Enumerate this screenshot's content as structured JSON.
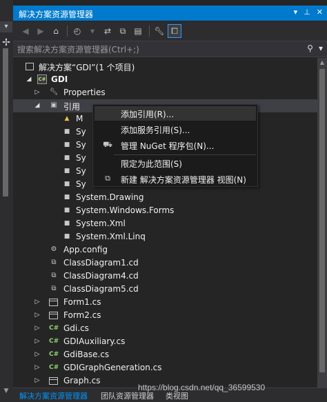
{
  "panel": {
    "title": "解决方案资源管理器",
    "title_icons": [
      "dropdown-arrow-icon",
      "pin-icon",
      "close-icon"
    ]
  },
  "toolbar": {
    "buttons": [
      "back-icon",
      "forward-icon",
      "home-icon",
      "history-icon",
      "sync-icon",
      "collapse-all-icon",
      "show-all-files-icon",
      "properties-icon",
      "preview-icon"
    ]
  },
  "search": {
    "placeholder": "搜索解决方案资源管理器(Ctrl+;)"
  },
  "tree": {
    "solution": "解决方案“GDI”(1 个项目)",
    "project": "GDI",
    "properties": "Properties",
    "references": "引用",
    "ref_items": [
      "M",
      "Sy",
      "Sy",
      "Sy",
      "Sy",
      "Sy",
      "System.Drawing",
      "System.Windows.Forms",
      "System.Xml",
      "System.Xml.Linq"
    ],
    "app_config": "App.config",
    "class_diagrams": [
      "ClassDiagram1.cd",
      "ClassDiagram4.cd",
      "ClassDiagram5.cd"
    ],
    "forms": [
      "Form1.cs",
      "Form2.cs"
    ],
    "cs_files": [
      "Gdi.cs",
      "GDIAuxiliary.cs",
      "GdiBase.cs",
      "GDIGraphGeneration.cs"
    ],
    "last_form": "Graph.cs"
  },
  "context_menu": {
    "items": [
      {
        "label": "添加引用(R)...",
        "icon": ""
      },
      {
        "label": "添加服务引用(S)...",
        "icon": ""
      },
      {
        "label": "管理 NuGet 程序包(N)...",
        "icon": "nuget-icon"
      },
      {
        "label": "限定为此范围(S)",
        "icon": ""
      },
      {
        "label": "新建 解决方案资源管理器 视图(N)",
        "icon": "new-view-icon"
      }
    ]
  },
  "bottom_tabs": {
    "active": "解决方案资源管理器",
    "inactive1": "团队资源管理器",
    "inactive2": "类视图"
  },
  "watermark": "https://blog.csdn.net/qq_36599530",
  "colors": {
    "accent": "#007acc",
    "background": "#252526",
    "selected_row": "#3f3f46",
    "menu_bg": "#1b1b1c"
  }
}
